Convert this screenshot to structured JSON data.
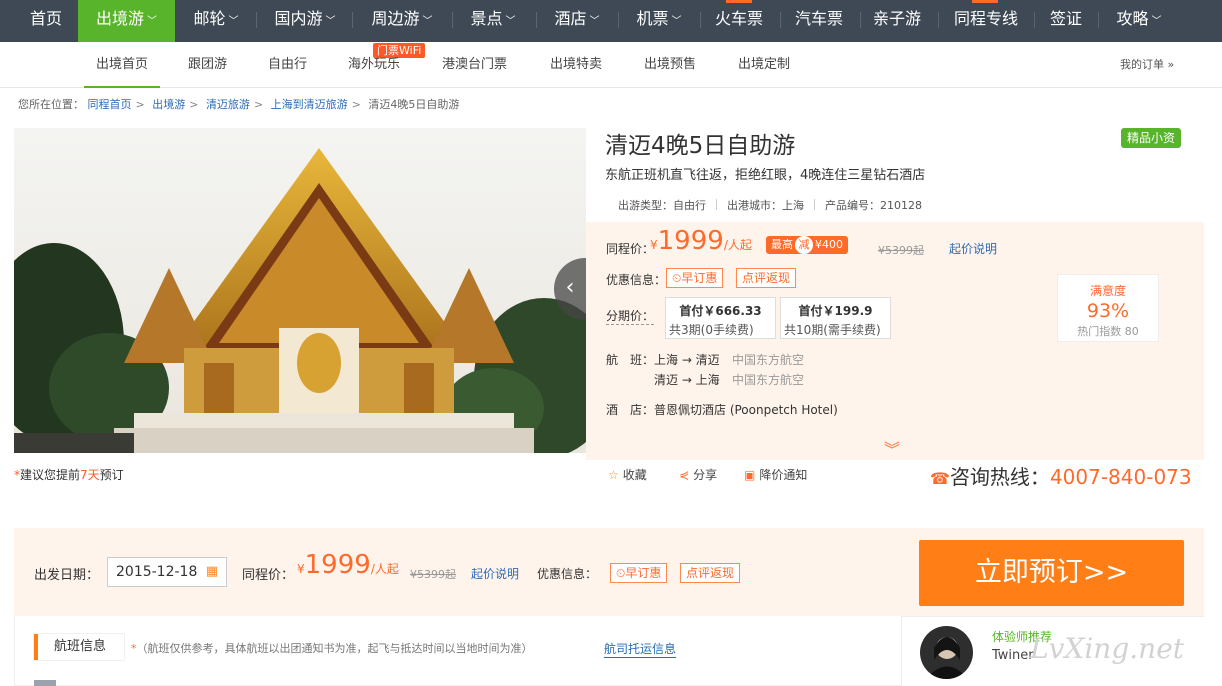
{
  "topnav": {
    "items": [
      {
        "label": "首页"
      },
      {
        "label": "出境游"
      },
      {
        "label": "邮轮"
      },
      {
        "label": "国内游"
      },
      {
        "label": "周边游"
      },
      {
        "label": "景点"
      },
      {
        "label": "酒店"
      },
      {
        "label": "机票"
      },
      {
        "label": "火车票"
      },
      {
        "label": "汽车票"
      },
      {
        "label": "亲子游"
      },
      {
        "label": "同程专线"
      },
      {
        "label": "签证"
      },
      {
        "label": "攻略"
      }
    ],
    "accent": "#58b42a",
    "bg": "#3f4955"
  },
  "subnav": {
    "items": [
      {
        "label": "出境首页"
      },
      {
        "label": "跟团游"
      },
      {
        "label": "自由行"
      },
      {
        "label": "海外玩乐"
      },
      {
        "label": "港澳台门票"
      },
      {
        "label": "出境特卖"
      },
      {
        "label": "出境预售"
      },
      {
        "label": "出境定制"
      }
    ],
    "flag": "门票WiFi",
    "my_orders": "我的订单"
  },
  "breadcrumb": {
    "prefix": "您所在位置：",
    "items": [
      "同程首页",
      "出境游",
      "清迈旅游",
      "上海到清迈旅游"
    ],
    "current": "清迈4晚5日自助游"
  },
  "hint": {
    "star": "*",
    "pre": "建议您提前",
    "days": "7天",
    "post": "预订"
  },
  "product": {
    "title": "清迈4晚5日自助游",
    "badge": "精品小资",
    "subtitle": "东航正班机直飞往返，拒绝红眼，4晚连住三星钻石酒店",
    "type": "出游类型：自由行",
    "city": "出港城市：上海",
    "code": "产品编号：210128"
  },
  "pricing": {
    "label": "同程价：",
    "currency": "¥",
    "price": "1999",
    "unit": "/人起",
    "max_label": "最高",
    "jian": "减",
    "discount": "¥400",
    "original": "¥5399起",
    "explain": "起价说明",
    "promo_label": "优惠信息：",
    "promo_1": "早订惠",
    "promo_2": "点评返现",
    "installment_label": "分期价：",
    "inst_1_top": "首付￥666.33",
    "inst_1_bottom": "共3期(0手续费)",
    "inst_2_top": "首付￥199.9",
    "inst_2_bottom": "共10期(需手续费)",
    "satisfy_title": "满意度",
    "satisfy_value": "93%",
    "satisfy_hot": "热门指数 80",
    "flight_label": "航　班：",
    "flight_1": "上海 → 清迈",
    "flight_1_air": "中国东方航空",
    "flight_2": "清迈 → 上海",
    "flight_2_air": "中国东方航空",
    "hotel_label": "酒　店：",
    "hotel": "普恩佩切酒店 (Poonpetch Hotel)"
  },
  "actions": {
    "fav": "收藏",
    "share": "分享",
    "notify": "降价通知",
    "hotline_label": "咨询热线：",
    "hotline": "4007-840-073"
  },
  "booking": {
    "date_label": "出发日期：",
    "date": "2015-12-18",
    "price_label": "同程价：",
    "currency": "¥",
    "price": "1999",
    "unit": "/人起",
    "original": "¥5399起",
    "explain": "起价说明",
    "promo_label": "优惠信息：",
    "promo_1": "早订惠",
    "promo_2": "点评返现",
    "button": "立即预订>>"
  },
  "bottom": {
    "flight_tab": "航班信息",
    "star": "*",
    "note": "（航班仅供参考，具体航班以出团通知书为准，起飞与抵达时间以当地时间为准）",
    "link": "航司托运信息",
    "expert_title": "体验师推荐",
    "expert_name": "Twiner",
    "watermark": "LvXing.net"
  }
}
